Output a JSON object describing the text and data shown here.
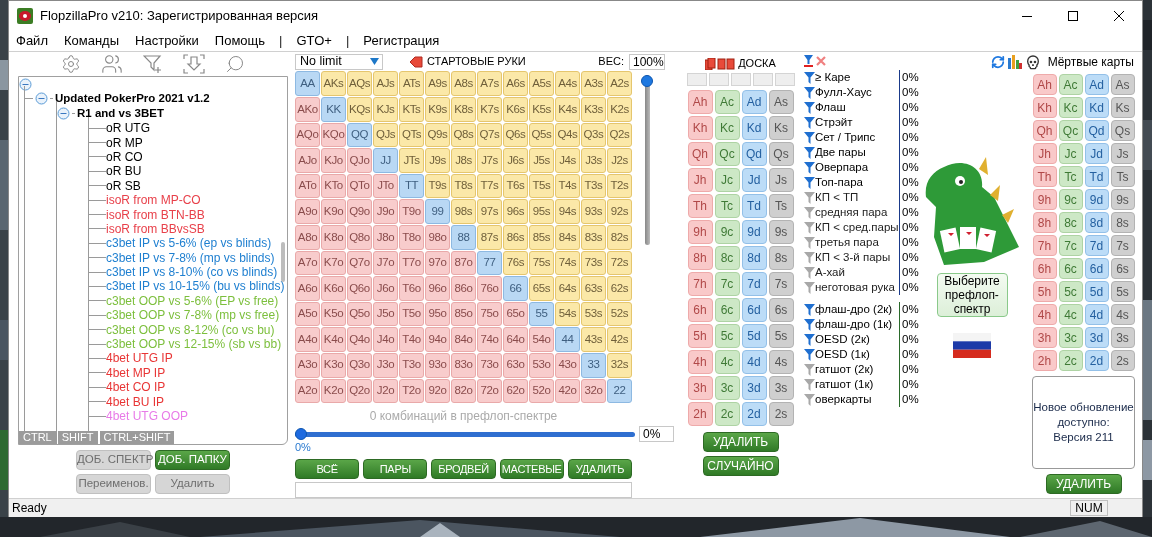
{
  "window": {
    "title": "FlopzillaPro v210: Зарегистрированная версия"
  },
  "menu": [
    {
      "kind": "item",
      "label": "Файл"
    },
    {
      "kind": "item",
      "label": "Команды"
    },
    {
      "kind": "item",
      "label": "Настройки"
    },
    {
      "kind": "item",
      "label": "Помощь"
    },
    {
      "kind": "separator",
      "label": "|"
    },
    {
      "kind": "item",
      "label": "GTO+"
    },
    {
      "kind": "separator",
      "label": "|"
    },
    {
      "kind": "item",
      "label": "Регистрация"
    }
  ],
  "tree": {
    "expanded": true,
    "children": [
      {
        "label": "Updated PokerPro 2021 v1.2",
        "expanded": true,
        "children": [
          {
            "label": "R1 and vs 3BET",
            "expanded": true,
            "children": [
              {
                "label": "oR UTG",
                "color": "#000000"
              },
              {
                "label": "oR MP",
                "color": "#000000"
              },
              {
                "label": "oR CO",
                "color": "#000000"
              },
              {
                "label": "oR BU",
                "color": "#000000"
              },
              {
                "label": "oR SB",
                "color": "#000000"
              },
              {
                "label": "isoR from MP-CO",
                "color": "#e8404a"
              },
              {
                "label": "isoR from BTN-BB",
                "color": "#e8404a"
              },
              {
                "label": "isoR from BBvsSB",
                "color": "#e8404a"
              },
              {
                "label": "c3bet IP vs 5-6% (ep vs blinds)",
                "color": "#1e7fd0"
              },
              {
                "label": "c3bet IP vs 7-8% (mp vs blinds)",
                "color": "#1e7fd0"
              },
              {
                "label": "c3bet IP vs 8-10% (co vs blinds)",
                "color": "#1e7fd0"
              },
              {
                "label": "c3bet IP vs 10-15% (bu vs blinds)",
                "color": "#1e7fd0"
              },
              {
                "label": "c3bet OOP vs 5-6% (EP vs free)",
                "color": "#7cbf3c"
              },
              {
                "label": "c3bet OOP vs 7-8% (mp vs free)",
                "color": "#7cbf3c"
              },
              {
                "label": "c3bet OOP vs 8-12% (co vs bu)",
                "color": "#7cbf3c"
              },
              {
                "label": "c3bet OOP vs 12-15% (sb vs bb)",
                "color": "#7cbf3c"
              },
              {
                "label": "4bet UTG IP",
                "color": "#e83535"
              },
              {
                "label": "4bet MP IP",
                "color": "#e83535"
              },
              {
                "label": "4bet CO IP",
                "color": "#e83535"
              },
              {
                "label": "4bet BU IP",
                "color": "#e83535"
              },
              {
                "label": "4bet UTG OOP",
                "color": "#e87ae8"
              }
            ]
          }
        ]
      }
    ]
  },
  "modifier_keys": [
    "CTRL",
    "SHIFT",
    "CTRL+SHIFT"
  ],
  "tree_buttons": [
    {
      "label": "ДОБ. СПЕКТР",
      "disabled": true
    },
    {
      "label": "ДОБ. ПАПКУ",
      "disabled": false
    },
    {
      "label": "Переименов.",
      "disabled": true
    },
    {
      "label": "Удалить",
      "disabled": true
    }
  ],
  "game_select": {
    "value": "No limit"
  },
  "hands_title": "СТАРТОВЫЕ РУКИ",
  "weight": {
    "label": "ВЕС:",
    "value": "100%",
    "level": 1
  },
  "hand_grid": {
    "rows": [
      [
        "AA",
        "AKs",
        "AQs",
        "AJs",
        "ATs",
        "A9s",
        "A8s",
        "A7s",
        "A6s",
        "A5s",
        "A4s",
        "A3s",
        "A2s"
      ],
      [
        "AKo",
        "KK",
        "KQs",
        "KJs",
        "KTs",
        "K9s",
        "K8s",
        "K7s",
        "K6s",
        "K5s",
        "K4s",
        "K3s",
        "K2s"
      ],
      [
        "AQo",
        "KQo",
        "QQ",
        "QJs",
        "QTs",
        "Q9s",
        "Q8s",
        "Q7s",
        "Q6s",
        "Q5s",
        "Q4s",
        "Q3s",
        "Q2s"
      ],
      [
        "AJo",
        "KJo",
        "QJo",
        "JJ",
        "JTs",
        "J9s",
        "J8s",
        "J7s",
        "J6s",
        "J5s",
        "J4s",
        "J3s",
        "J2s"
      ],
      [
        "ATo",
        "KTo",
        "QTo",
        "JTo",
        "TT",
        "T9s",
        "T8s",
        "T7s",
        "T6s",
        "T5s",
        "T4s",
        "T3s",
        "T2s"
      ],
      [
        "A9o",
        "K9o",
        "Q9o",
        "J9o",
        "T9o",
        "99",
        "98s",
        "97s",
        "96s",
        "95s",
        "94s",
        "93s",
        "92s"
      ],
      [
        "A8o",
        "K8o",
        "Q8o",
        "J8o",
        "T8o",
        "98o",
        "88",
        "87s",
        "86s",
        "85s",
        "84s",
        "83s",
        "82s"
      ],
      [
        "A7o",
        "K7o",
        "Q7o",
        "J7o",
        "T7o",
        "97o",
        "87o",
        "77",
        "76s",
        "75s",
        "74s",
        "73s",
        "72s"
      ],
      [
        "A6o",
        "K6o",
        "Q6o",
        "J6o",
        "T6o",
        "96o",
        "86o",
        "76o",
        "66",
        "65s",
        "64s",
        "63s",
        "62s"
      ],
      [
        "A5o",
        "K5o",
        "Q5o",
        "J5o",
        "T5o",
        "95o",
        "85o",
        "75o",
        "65o",
        "55",
        "54s",
        "53s",
        "52s"
      ],
      [
        "A4o",
        "K4o",
        "Q4o",
        "J4o",
        "T4o",
        "94o",
        "84o",
        "74o",
        "64o",
        "54o",
        "44",
        "43s",
        "42s"
      ],
      [
        "A3o",
        "K3o",
        "Q3o",
        "J3o",
        "T3o",
        "93o",
        "83o",
        "73o",
        "63o",
        "53o",
        "43o",
        "33",
        "32s"
      ],
      [
        "A2o",
        "K2o",
        "Q2o",
        "J2o",
        "T2o",
        "92o",
        "82o",
        "72o",
        "62o",
        "52o",
        "42o",
        "32o",
        "22"
      ]
    ]
  },
  "combos_caption": "0 комбинаций в префлоп-спектре",
  "range_slider": {
    "level": 0,
    "value": "0%",
    "reading": "0%"
  },
  "range_buttons": [
    "ВСЁ",
    "ПАРЫ",
    "БРОДВЕЙ",
    "МАСТЕВЫЕ",
    "УДАЛИТЬ"
  ],
  "board": {
    "title": "ДОСКА",
    "cards": [
      [
        "Ah",
        "Ac",
        "Ad",
        "As"
      ],
      [
        "Kh",
        "Kc",
        "Kd",
        "Ks"
      ],
      [
        "Qh",
        "Qc",
        "Qd",
        "Qs"
      ],
      [
        "Jh",
        "Jc",
        "Jd",
        "Js"
      ],
      [
        "Th",
        "Tc",
        "Td",
        "Ts"
      ],
      [
        "9h",
        "9c",
        "9d",
        "9s"
      ],
      [
        "8h",
        "8c",
        "8d",
        "8s"
      ],
      [
        "7h",
        "7c",
        "7d",
        "7s"
      ],
      [
        "6h",
        "6c",
        "6d",
        "6s"
      ],
      [
        "5h",
        "5c",
        "5d",
        "5s"
      ],
      [
        "4h",
        "4c",
        "4d",
        "4s"
      ],
      [
        "3h",
        "3c",
        "3d",
        "3s"
      ],
      [
        "2h",
        "2c",
        "2d",
        "2s"
      ]
    ],
    "buttons": [
      "УДАЛИТЬ",
      "СЛУЧАЙНО"
    ]
  },
  "made_hands": [
    {
      "label": "≥ Каре",
      "value": "0%",
      "active": true
    },
    {
      "label": "Фулл-Хаус",
      "value": "0%",
      "active": true
    },
    {
      "label": "Флаш",
      "value": "0%",
      "active": true
    },
    {
      "label": "Стрэйт",
      "value": "0%",
      "active": true
    },
    {
      "label": "Сет / Трипс",
      "value": "0%",
      "active": true
    },
    {
      "label": "Две пары",
      "value": "0%",
      "active": true
    },
    {
      "label": "Оверпара",
      "value": "0%",
      "active": true
    },
    {
      "label": "Топ-пара",
      "value": "0%",
      "active": true
    },
    {
      "label": "КП < ТП",
      "value": "0%",
      "active": false
    },
    {
      "label": "средняя пара",
      "value": "0%",
      "active": false
    },
    {
      "label": "КП < сред.пары",
      "value": "0%",
      "active": false
    },
    {
      "label": "третья пара",
      "value": "0%",
      "active": false
    },
    {
      "label": "КП < 3-й пары",
      "value": "0%",
      "active": false
    },
    {
      "label": "А-хай",
      "value": "0%",
      "active": false
    },
    {
      "label": "неготовая рука",
      "value": "0%",
      "active": false
    }
  ],
  "draws": [
    {
      "label": "флаш-дро (2к)",
      "value": "0%",
      "active": true
    },
    {
      "label": "флаш-дро (1к)",
      "value": "0%",
      "active": true
    },
    {
      "label": "OESD (2к)",
      "value": "0%",
      "active": true
    },
    {
      "label": "OESD (1к)",
      "value": "0%",
      "active": true
    },
    {
      "label": "гатшот (2к)",
      "value": "0%",
      "active": false
    },
    {
      "label": "гатшот (1к)",
      "value": "0%",
      "active": false
    },
    {
      "label": "оверкарты",
      "value": "0%",
      "active": false
    }
  ],
  "select_range_button": "Выберите префлоп-спектр",
  "dead_cards": {
    "title": "Мёртвые карты",
    "cards": [
      [
        "Ah",
        "Ac",
        "Ad",
        "As"
      ],
      [
        "Kh",
        "Kc",
        "Kd",
        "Ks"
      ],
      [
        "Qh",
        "Qc",
        "Qd",
        "Qs"
      ],
      [
        "Jh",
        "Jc",
        "Jd",
        "Js"
      ],
      [
        "Th",
        "Tc",
        "Td",
        "Ts"
      ],
      [
        "9h",
        "9c",
        "9d",
        "9s"
      ],
      [
        "8h",
        "8c",
        "8d",
        "8s"
      ],
      [
        "7h",
        "7c",
        "7d",
        "7s"
      ],
      [
        "6h",
        "6c",
        "6d",
        "6s"
      ],
      [
        "5h",
        "5c",
        "5d",
        "5s"
      ],
      [
        "4h",
        "4c",
        "4d",
        "4s"
      ],
      [
        "3h",
        "3c",
        "3d",
        "3s"
      ],
      [
        "2h",
        "2c",
        "2d",
        "2s"
      ]
    ],
    "button": "УДАЛИТЬ"
  },
  "update_notice": [
    "Новое обновление доступно:",
    "Версия 211"
  ],
  "status_bar": {
    "text": "Ready",
    "num": "NUM"
  }
}
